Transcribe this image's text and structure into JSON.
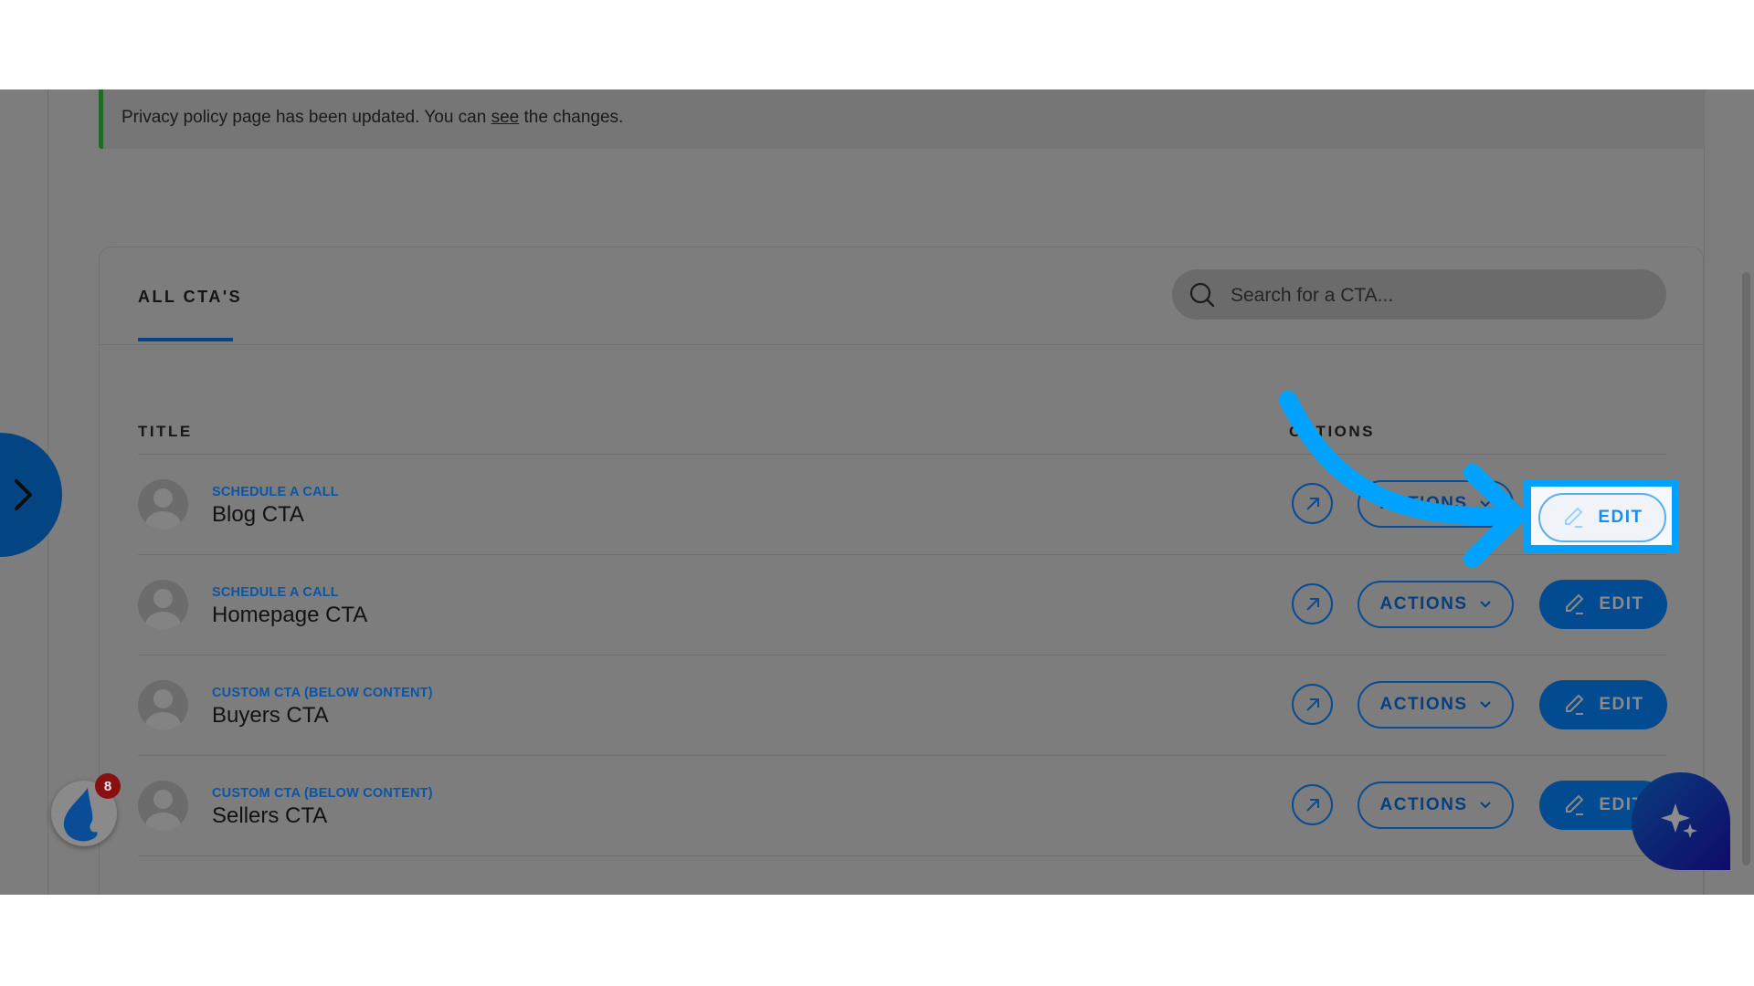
{
  "notice": {
    "text_before": "Privacy policy page has been updated. You can ",
    "link": "see",
    "text_after": " the changes.",
    "accent_color": "#1f6b2a"
  },
  "tabs": [
    {
      "label": "ALL CTA'S",
      "active": true
    }
  ],
  "search": {
    "placeholder": "Search for a CTA...",
    "value": "",
    "icon": "search-icon"
  },
  "table": {
    "columns": [
      "TITLE",
      "OPTIONS"
    ],
    "rows": [
      {
        "type": "SCHEDULE A CALL",
        "title": "Blog CTA",
        "actions_label": "ACTIONS",
        "edit_label": "EDIT",
        "highlighted": true
      },
      {
        "type": "SCHEDULE A CALL",
        "title": "Homepage CTA",
        "actions_label": "ACTIONS",
        "edit_label": "EDIT"
      },
      {
        "type": "CUSTOM CTA (BELOW CONTENT)",
        "title": "Buyers CTA",
        "actions_label": "ACTIONS",
        "edit_label": "EDIT"
      },
      {
        "type": "CUSTOM CTA (BELOW CONTENT)",
        "title": "Sellers CTA",
        "actions_label": "ACTIONS",
        "edit_label": "EDIT"
      }
    ]
  },
  "widgets": {
    "notification_count": "8",
    "accent_color": "#034b91",
    "highlight_color": "#00a2ff"
  }
}
